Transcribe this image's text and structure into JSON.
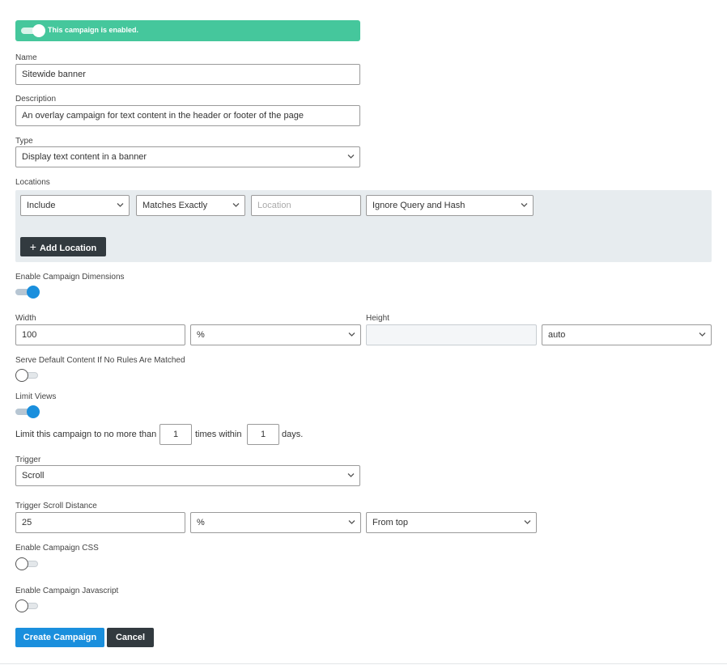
{
  "status_banner": {
    "text": "This campaign is enabled.",
    "enabled": true,
    "color": "#45c79c"
  },
  "name": {
    "label": "Name",
    "value": "Sitewide banner"
  },
  "description": {
    "label": "Description",
    "value": "An overlay campaign for text content in the header or footer of the page"
  },
  "type": {
    "label": "Type",
    "value": "Display text content in a banner"
  },
  "locations": {
    "label": "Locations",
    "rule": {
      "include": "Include",
      "match": "Matches Exactly",
      "location_placeholder": "Location",
      "query": "Ignore Query and Hash"
    },
    "add_button": "Add Location"
  },
  "dimensions": {
    "label": "Enable Campaign Dimensions",
    "enabled": true,
    "width_label": "Width",
    "width_value": "100",
    "width_unit": "%",
    "height_label": "Height",
    "height_value": "",
    "height_unit": "auto"
  },
  "serve_default": {
    "label": "Serve Default Content If No Rules Are Matched",
    "enabled": false
  },
  "limit_views": {
    "label": "Limit Views",
    "enabled": true,
    "prefix": "Limit this campaign to no more than",
    "times": "1",
    "middle": "times within",
    "days": "1",
    "suffix": "days."
  },
  "trigger": {
    "label": "Trigger",
    "value": "Scroll"
  },
  "scroll_distance": {
    "label": "Trigger Scroll Distance",
    "value": "25",
    "unit": "%",
    "origin": "From top"
  },
  "campaign_css": {
    "label": "Enable Campaign CSS",
    "enabled": false
  },
  "campaign_js": {
    "label": "Enable Campaign Javascript",
    "enabled": false
  },
  "actions": {
    "create": "Create Campaign",
    "cancel": "Cancel"
  },
  "colors": {
    "primary": "#1a8fdd",
    "dark": "#323a3f",
    "panel": "#e7ecef"
  }
}
